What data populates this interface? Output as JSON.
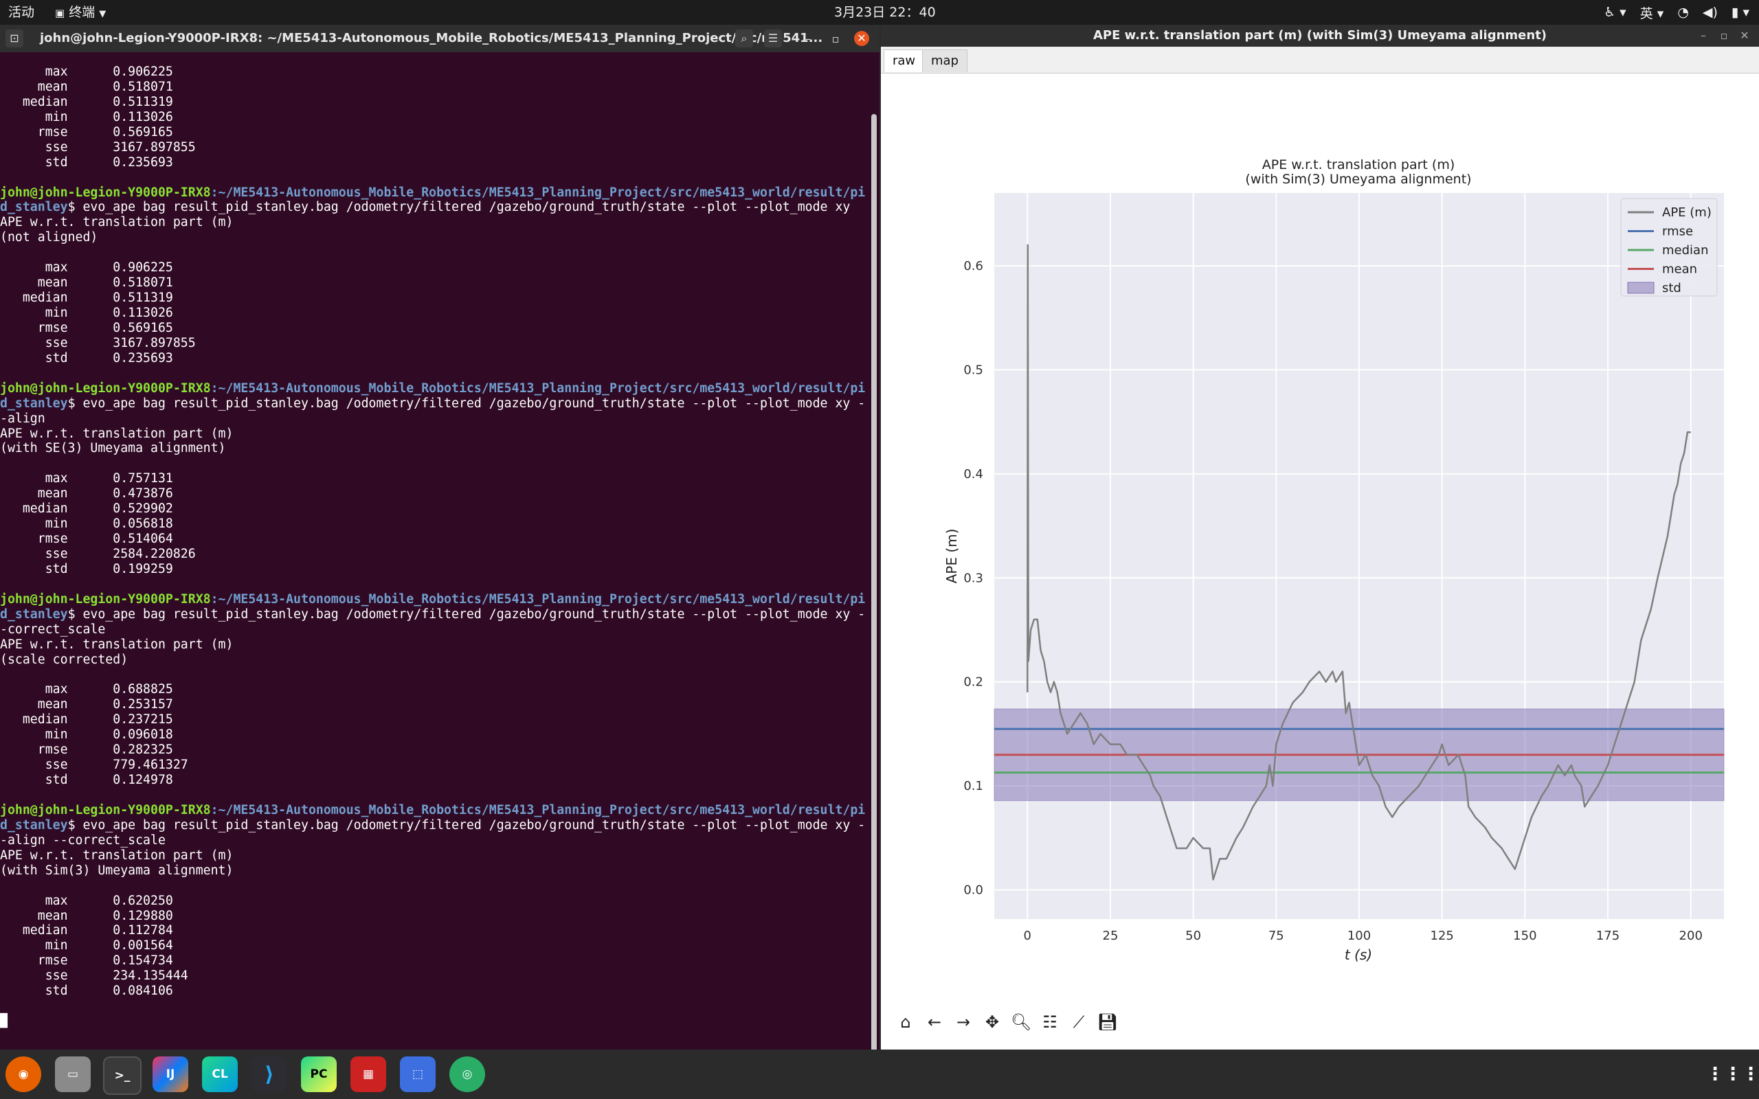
{
  "topbar": {
    "activities": "活动",
    "app_menu": "终端",
    "clock": "3月23日  22：40",
    "lang": "英"
  },
  "terminal": {
    "title": "john@john-Legion-Y9000P-IRX8: ~/ME5413-Autonomous_Mobile_Robotics/ME5413_Planning_Project/src/me541...",
    "lines": [
      {
        "t": "      max      0.906225"
      },
      {
        "t": "     mean      0.518071"
      },
      {
        "t": "   median      0.511319"
      },
      {
        "t": "      min      0.113026"
      },
      {
        "t": "     rmse      0.569165"
      },
      {
        "t": "      sse      3167.897855"
      },
      {
        "t": "      std      0.235693"
      },
      {
        "t": ""
      },
      {
        "u": "john@john-Legion-Y9000P-IRX8",
        "p": ":~/ME5413-Autonomous_Mobile_Robotics/ME5413_Planning_Project/src/me5413_world/result/pi"
      },
      {
        "p": "d_stanley",
        "t": "$ evo_ape bag result_pid_stanley.bag /odometry/filtered /gazebo/ground_truth/state --plot --plot_mode xy"
      },
      {
        "t": "APE w.r.t. translation part (m)"
      },
      {
        "t": "(not aligned)"
      },
      {
        "t": ""
      },
      {
        "t": "      max      0.906225"
      },
      {
        "t": "     mean      0.518071"
      },
      {
        "t": "   median      0.511319"
      },
      {
        "t": "      min      0.113026"
      },
      {
        "t": "     rmse      0.569165"
      },
      {
        "t": "      sse      3167.897855"
      },
      {
        "t": "      std      0.235693"
      },
      {
        "t": ""
      },
      {
        "u": "john@john-Legion-Y9000P-IRX8",
        "p": ":~/ME5413-Autonomous_Mobile_Robotics/ME5413_Planning_Project/src/me5413_world/result/pi"
      },
      {
        "p": "d_stanley",
        "t": "$ evo_ape bag result_pid_stanley.bag /odometry/filtered /gazebo/ground_truth/state --plot --plot_mode xy -"
      },
      {
        "t": "-align"
      },
      {
        "t": "APE w.r.t. translation part (m)"
      },
      {
        "t": "(with SE(3) Umeyama alignment)"
      },
      {
        "t": ""
      },
      {
        "t": "      max      0.757131"
      },
      {
        "t": "     mean      0.473876"
      },
      {
        "t": "   median      0.529902"
      },
      {
        "t": "      min      0.056818"
      },
      {
        "t": "     rmse      0.514064"
      },
      {
        "t": "      sse      2584.220826"
      },
      {
        "t": "      std      0.199259"
      },
      {
        "t": ""
      },
      {
        "u": "john@john-Legion-Y9000P-IRX8",
        "p": ":~/ME5413-Autonomous_Mobile_Robotics/ME5413_Planning_Project/src/me5413_world/result/pi"
      },
      {
        "p": "d_stanley",
        "t": "$ evo_ape bag result_pid_stanley.bag /odometry/filtered /gazebo/ground_truth/state --plot --plot_mode xy -"
      },
      {
        "t": "-correct_scale"
      },
      {
        "t": "APE w.r.t. translation part (m)"
      },
      {
        "t": "(scale corrected)"
      },
      {
        "t": ""
      },
      {
        "t": "      max      0.688825"
      },
      {
        "t": "     mean      0.253157"
      },
      {
        "t": "   median      0.237215"
      },
      {
        "t": "      min      0.096018"
      },
      {
        "t": "     rmse      0.282325"
      },
      {
        "t": "      sse      779.461327"
      },
      {
        "t": "      std      0.124978"
      },
      {
        "t": ""
      },
      {
        "u": "john@john-Legion-Y9000P-IRX8",
        "p": ":~/ME5413-Autonomous_Mobile_Robotics/ME5413_Planning_Project/src/me5413_world/result/pi"
      },
      {
        "p": "d_stanley",
        "t": "$ evo_ape bag result_pid_stanley.bag /odometry/filtered /gazebo/ground_truth/state --plot --plot_mode xy -"
      },
      {
        "t": "-align --correct_scale"
      },
      {
        "t": "APE w.r.t. translation part (m)"
      },
      {
        "t": "(with Sim(3) Umeyama alignment)"
      },
      {
        "t": ""
      },
      {
        "t": "      max      0.620250"
      },
      {
        "t": "     mean      0.129880"
      },
      {
        "t": "   median      0.112784"
      },
      {
        "t": "      min      0.001564"
      },
      {
        "t": "     rmse      0.154734"
      },
      {
        "t": "      sse      234.135444"
      },
      {
        "t": "      std      0.084106"
      },
      {
        "t": ""
      },
      {
        "t": "█"
      }
    ]
  },
  "plot_window": {
    "title": "APE w.r.t. translation part (m) (with Sim(3) Umeyama alignment)",
    "tabs": [
      "raw",
      "map"
    ],
    "toolbar": [
      "home-icon",
      "back-icon",
      "forward-icon",
      "pan-icon",
      "zoom-icon",
      "configure-icon",
      "edit-axis-icon",
      "save-icon"
    ]
  },
  "chart_data": {
    "type": "line",
    "title": "APE w.r.t. translation part (m)",
    "subtitle": "(with Sim(3) Umeyama alignment)",
    "xlabel": "t (s)",
    "ylabel": "APE (m)",
    "xlim": [
      -10,
      210
    ],
    "ylim": [
      -0.028,
      0.67
    ],
    "xticks": [
      0,
      25,
      50,
      75,
      100,
      125,
      150,
      175,
      200
    ],
    "yticks": [
      0.0,
      0.1,
      0.2,
      0.3,
      0.4,
      0.5,
      0.6
    ],
    "grid": true,
    "legend": "top-right",
    "series": [
      {
        "name": "APE (m)",
        "color": "#7f7f7f",
        "x": [
          0,
          0.1,
          0.3,
          1,
          2,
          3,
          4,
          5,
          6,
          7,
          8,
          9,
          10,
          12,
          14,
          16,
          18,
          20,
          22,
          25,
          28,
          30,
          33,
          35,
          37,
          38,
          40,
          42,
          45,
          48,
          50,
          53,
          55,
          56,
          58,
          60,
          63,
          65,
          68,
          70,
          72,
          73,
          74,
          75,
          77,
          80,
          83,
          85,
          88,
          90,
          92,
          93,
          95,
          96,
          97,
          98,
          100,
          102,
          104,
          106,
          108,
          110,
          112,
          115,
          118,
          120,
          122,
          124,
          125,
          127,
          130,
          132,
          133,
          135,
          138,
          140,
          143,
          145,
          147,
          148,
          150,
          152,
          155,
          157,
          160,
          162,
          164,
          165,
          167,
          168,
          170,
          172,
          175,
          177,
          180,
          183,
          185,
          188,
          190,
          193,
          195,
          196,
          197,
          198,
          199,
          200
        ],
        "y": [
          0.19,
          0.62,
          0.22,
          0.25,
          0.26,
          0.26,
          0.23,
          0.22,
          0.2,
          0.19,
          0.2,
          0.19,
          0.17,
          0.15,
          0.16,
          0.17,
          0.16,
          0.14,
          0.15,
          0.14,
          0.14,
          0.13,
          0.13,
          0.12,
          0.11,
          0.1,
          0.09,
          0.07,
          0.04,
          0.04,
          0.05,
          0.04,
          0.04,
          0.01,
          0.03,
          0.03,
          0.05,
          0.06,
          0.08,
          0.09,
          0.1,
          0.12,
          0.1,
          0.14,
          0.16,
          0.18,
          0.19,
          0.2,
          0.21,
          0.2,
          0.21,
          0.2,
          0.21,
          0.17,
          0.18,
          0.16,
          0.12,
          0.13,
          0.11,
          0.1,
          0.08,
          0.07,
          0.08,
          0.09,
          0.1,
          0.11,
          0.12,
          0.13,
          0.14,
          0.12,
          0.13,
          0.11,
          0.08,
          0.07,
          0.06,
          0.05,
          0.04,
          0.03,
          0.02,
          0.03,
          0.05,
          0.07,
          0.09,
          0.1,
          0.12,
          0.11,
          0.12,
          0.11,
          0.1,
          0.08,
          0.09,
          0.1,
          0.12,
          0.14,
          0.17,
          0.2,
          0.24,
          0.27,
          0.3,
          0.34,
          0.38,
          0.39,
          0.41,
          0.42,
          0.44,
          0.44
        ]
      },
      {
        "name": "rmse",
        "color": "#4c72b0",
        "value": 0.154734
      },
      {
        "name": "median",
        "color": "#55a868",
        "value": 0.112784
      },
      {
        "name": "mean",
        "color": "#c44e52",
        "value": 0.12988
      },
      {
        "name": "std",
        "color": "#8172b2",
        "range": [
          0.0858,
          0.174
        ]
      }
    ]
  },
  "dock": {
    "apps": [
      "firefox-icon",
      "files-icon",
      "terminal-icon",
      "intellij-icon",
      "clion-icon",
      "vscode-icon",
      "pycharm-icon",
      "video-icon",
      "screenshot-icon",
      "wechat-icon"
    ],
    "labels": {
      "terminal": ">_",
      "intellij": "IJ",
      "clion": "CL",
      "pycharm": "PC"
    }
  }
}
